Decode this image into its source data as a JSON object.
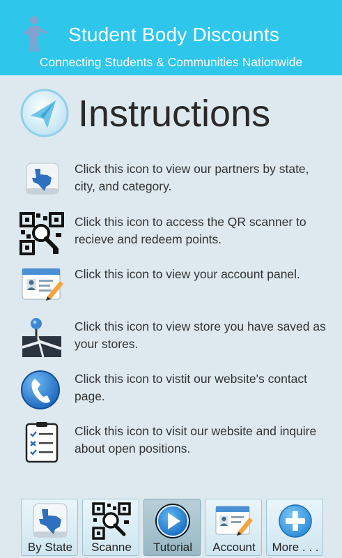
{
  "header": {
    "title": "Student Body Discounts",
    "subtitle": "Connecting Students & Communities Nationwide"
  },
  "page": {
    "heading": "Instructions"
  },
  "instructions": [
    {
      "icon": "texas-map-icon",
      "text": "Click this icon to view our partners by state, city, and category."
    },
    {
      "icon": "qr-scanner-icon",
      "text": "Click this icon to access the QR scanner to recieve and redeem points."
    },
    {
      "icon": "account-card-icon",
      "text": "Click this icon to view your account panel."
    },
    {
      "icon": "map-pin-icon",
      "text": "Click this icon to view store you have saved as your stores."
    },
    {
      "icon": "phone-icon",
      "text": "Click this icon to vistit our website's contact page."
    },
    {
      "icon": "checklist-icon",
      "text": "Click this icon to visit our website and inquire about open positions."
    }
  ],
  "nav": [
    {
      "label": "By State",
      "icon": "texas-map-icon",
      "active": false
    },
    {
      "label": "Scanne",
      "icon": "qr-scanner-icon",
      "active": false
    },
    {
      "label": "Tutorial",
      "icon": "play-icon",
      "active": true
    },
    {
      "label": "Account",
      "icon": "account-card-icon",
      "active": false
    },
    {
      "label": "More . . .",
      "icon": "plus-icon",
      "active": false
    }
  ],
  "colors": {
    "header_bg": "#2fc6ec",
    "page_bg": "#dde9ee",
    "accent_blue": "#1e88d6"
  }
}
